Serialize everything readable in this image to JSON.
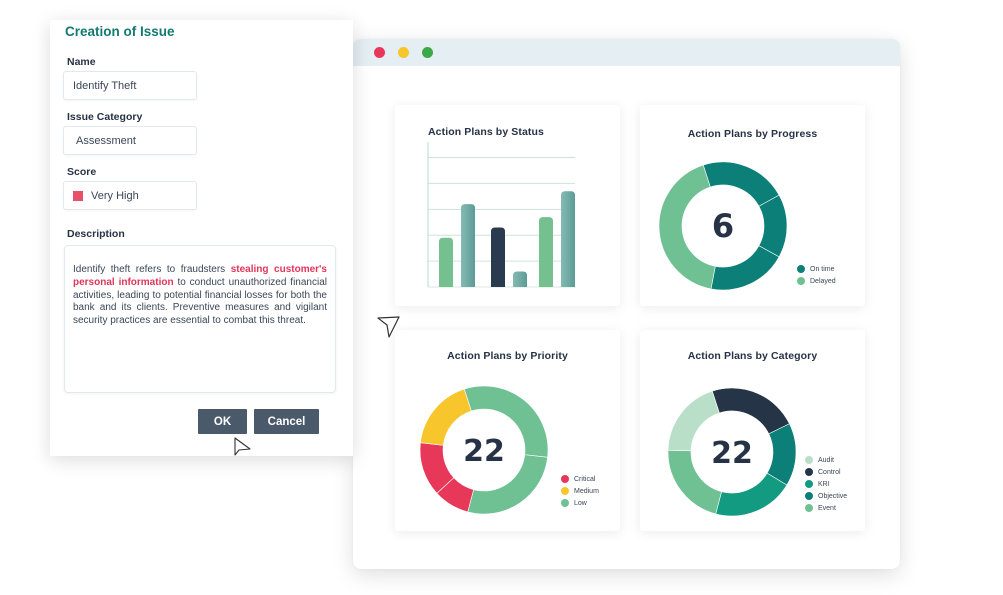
{
  "dialog": {
    "title": "Creation of Issue",
    "fields": [
      {
        "label": "Name",
        "value": "Identify Theft"
      },
      {
        "label": "Issue Category",
        "value": "Assessment"
      },
      {
        "label": "Score",
        "value": "Very High",
        "swatch_color": "#e8506a"
      }
    ],
    "description": {
      "label": "Description",
      "text_before": "Identify theft refers to fraudsters ",
      "highlight": "stealing customer's personal information",
      "text_after": " to conduct unauthorized financial activities, leading to potential financial losses for both the bank and its clients. Preventive measures and vigilant security practices are essential to combat this threat.",
      "highlight_color": "#e0355a"
    },
    "buttons": {
      "ok": "OK",
      "cancel": "Cancel"
    }
  },
  "window": {
    "controls": [
      "close",
      "minimize",
      "maximize"
    ]
  },
  "chart_data": [
    {
      "type": "bar",
      "title": "Action Plans by Status",
      "xlabel": "",
      "ylabel": "",
      "grid": true,
      "ylim": [
        0,
        5.6
      ],
      "gridlines": [
        1,
        2,
        3,
        4,
        5
      ],
      "groups": [
        {
          "bars": [
            {
              "value": 1.9,
              "color": "#74c18f"
            },
            {
              "value": 3.2,
              "color": "#6fa8a2"
            }
          ]
        },
        {
          "bars": [
            {
              "value": 2.3,
              "color": "#2a3a4f"
            },
            {
              "value": 0.6,
              "color": "#6fa8a2"
            }
          ]
        },
        {
          "bars": [
            {
              "value": 2.7,
              "color": "#74c18f"
            },
            {
              "value": 3.7,
              "color": "#6fa8a2"
            }
          ]
        }
      ]
    },
    {
      "type": "pie",
      "title": "Action Plans by Progress",
      "center_label": "6",
      "legend_position": "bottom-right",
      "legend": [
        {
          "label": "On time",
          "color": "#0b7f78"
        },
        {
          "label": "Delayed",
          "color": "#6fc093"
        }
      ],
      "slices": [
        {
          "label": "On time",
          "value": 22,
          "color": "#0b7f78"
        },
        {
          "label": "On time",
          "value": 16,
          "color": "#0b7f78"
        },
        {
          "label": "On time",
          "value": 20,
          "color": "#0b7f78"
        },
        {
          "label": "Delayed",
          "value": 42,
          "color": "#6fc093"
        }
      ],
      "start_angle_deg": -18
    },
    {
      "type": "pie",
      "title": "Action Plans by Priority",
      "center_label": "22",
      "legend_position": "bottom-right",
      "legend": [
        {
          "label": "Critical",
          "color": "#e8385a"
        },
        {
          "label": "Medium",
          "color": "#f7c52c"
        },
        {
          "label": "Low",
          "color": "#6fc093"
        }
      ],
      "slices": [
        {
          "label": "Low",
          "value": 7,
          "color": "#6fc093"
        },
        {
          "label": "Low",
          "value": 6,
          "color": "#6fc093"
        },
        {
          "label": "Critical",
          "value": 2,
          "color": "#e8385a"
        },
        {
          "label": "Critical",
          "value": 3,
          "color": "#e8385a"
        },
        {
          "label": "Medium",
          "value": 4,
          "color": "#f7c52c"
        }
      ],
      "start_angle_deg": -18
    },
    {
      "type": "pie",
      "title": "Action Plans by Category",
      "center_label": "22",
      "legend_position": "bottom-right",
      "legend": [
        {
          "label": "Audit",
          "color": "#b9dfc9"
        },
        {
          "label": "Control",
          "color": "#263447"
        },
        {
          "label": "KRI",
          "color": "#129b80"
        },
        {
          "label": "Objective",
          "color": "#0b7f78"
        },
        {
          "label": "Event",
          "color": "#6fc093"
        }
      ],
      "slices": [
        {
          "label": "Control",
          "value": 5,
          "color": "#263447"
        },
        {
          "label": "Objective",
          "value": 3.5,
          "color": "#0b7f78"
        },
        {
          "label": "KRI",
          "value": 4.5,
          "color": "#129b80"
        },
        {
          "label": "Event",
          "value": 4.7,
          "color": "#6fc093"
        },
        {
          "label": "Audit",
          "value": 4.3,
          "color": "#b9dfc9"
        }
      ],
      "start_angle_deg": -18
    }
  ]
}
